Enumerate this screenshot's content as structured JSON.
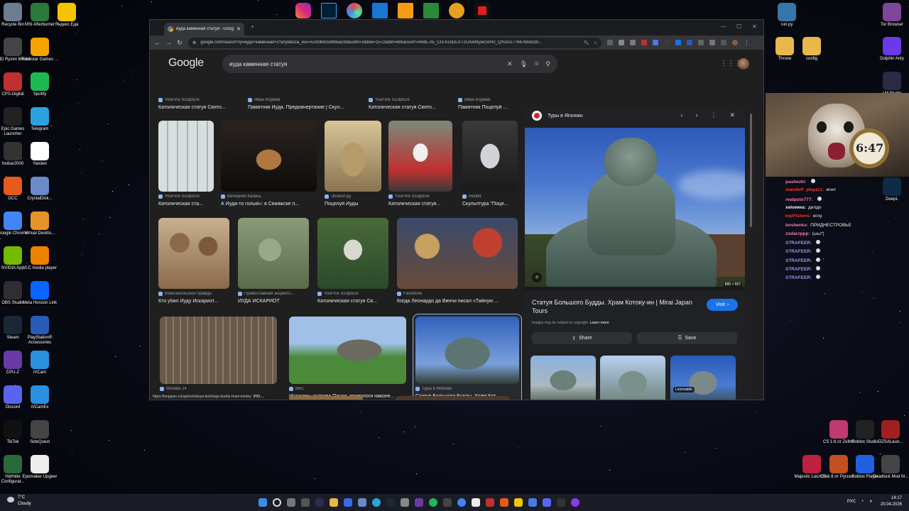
{
  "desktop": {
    "left_icons": [
      {
        "label": "Recycle Bin",
        "icon": "recycle-bin-icon",
        "color": "#6b7d8e"
      },
      {
        "label": "MSI Afterburner",
        "icon": "afterburner-icon",
        "color": "#2a7a3a"
      },
      {
        "label": "Яндекс.Еда",
        "icon": "yandex-eda-icon",
        "color": "#f5c400"
      },
      {
        "label": "AMD Ryzen Master",
        "icon": "amd-icon",
        "color": "#444"
      },
      {
        "label": "Rockstar Games ...",
        "icon": "rockstar-icon",
        "color": "#f4a300"
      },
      {
        "label": "CPS-Digital",
        "icon": "cps-icon",
        "color": "#c03030"
      },
      {
        "label": "Spotify",
        "icon": "spotify-icon",
        "color": "#1db954"
      },
      {
        "label": "Epic Games Launcher",
        "icon": "epic-icon",
        "color": "#222"
      },
      {
        "label": "Telegram",
        "icon": "telegram-icon",
        "color": "#2aa3df"
      },
      {
        "label": "foobar2000",
        "icon": "foobar-icon",
        "color": "#333"
      },
      {
        "label": "Yandex",
        "icon": "yandex-icon",
        "color": "#fff"
      },
      {
        "label": "GCC",
        "icon": "gcc-icon",
        "color": "#e85a1a"
      },
      {
        "label": "CrystalDisk...",
        "icon": "crystaldisk-icon",
        "color": "#6a8ac8"
      },
      {
        "label": "Google Chrome",
        "icon": "chrome-icon",
        "color": "#4285f4"
      },
      {
        "label": "Virtual Deskto...",
        "icon": "virtual-desktop-icon",
        "color": "#e8922a"
      },
      {
        "label": "NVIDIA App",
        "icon": "nvidia-icon",
        "color": "#76b900"
      },
      {
        "label": "VLC media player",
        "icon": "vlc-icon",
        "color": "#f08000"
      },
      {
        "label": "OBS Studio",
        "icon": "obs-icon",
        "color": "#302e31"
      },
      {
        "label": "Meta Horizon Link",
        "icon": "meta-icon",
        "color": "#0866ff"
      },
      {
        "label": "Steam",
        "icon": "steam-icon",
        "color": "#1b2838"
      },
      {
        "label": "PlayStation® Accessories",
        "icon": "playstation-icon",
        "color": "#2a5ab8"
      },
      {
        "label": "CPU-Z",
        "icon": "cpuz-icon",
        "color": "#6a3aa8"
      },
      {
        "label": "iVCam",
        "icon": "ivcam-icon",
        "color": "#2a90e0"
      },
      {
        "label": "Discord",
        "icon": "discord-icon",
        "color": "#5865f2"
      },
      {
        "label": "iVCamEx",
        "icon": "ivcamex-icon",
        "color": "#2a90e0"
      },
      {
        "label": "TikTok",
        "icon": "tiktok-icon",
        "color": "#111"
      },
      {
        "label": "SideQuest",
        "icon": "sidequest-icon",
        "color": "#444"
      },
      {
        "label": "HidHide Configurat...",
        "icon": "hidhide-icon",
        "color": "#2a6a3a"
      },
      {
        "label": "Epomaker Upgeer",
        "icon": "epomaker-icon",
        "color": "#eee"
      }
    ],
    "right_icons": [
      {
        "label": "run.py",
        "icon": "python-file-icon",
        "color": "#3776ab"
      },
      {
        "label": "Tor Browser",
        "icon": "tor-icon",
        "color": "#7d4698"
      },
      {
        "label": "Throne",
        "icon": "folder-icon",
        "color": "#e8b84a"
      },
      {
        "label": "config",
        "icon": "folder-icon",
        "color": "#e8b84a"
      },
      {
        "label": "Dolphin Anty",
        "icon": "dolphin-icon",
        "color": "#6a3ae8"
      },
      {
        "label": "LM Studio",
        "icon": "lmstudio-icon",
        "color": "#2a2a44"
      },
      {
        "label": "DeepL",
        "icon": "deepl-icon",
        "color": "#0f2b46"
      },
      {
        "label": "CS 1.6 от Zeihts",
        "icon": "cs-icon",
        "color": "#c03a70"
      },
      {
        "label": "Roblox Studio",
        "icon": "roblox-studio-icon",
        "color": "#222"
      },
      {
        "label": "DZSALaun...",
        "icon": "dzsa-icon",
        "color": "#a02020"
      },
      {
        "label": "Majestic Launcher",
        "icon": "majestic-icon",
        "color": "#c02040"
      },
      {
        "label": "CS 1.6 от Русско...",
        "icon": "cs-icon",
        "color": "#c05020"
      },
      {
        "label": "Roblox Player",
        "icon": "roblox-icon",
        "color": "#2060e0"
      },
      {
        "label": "Deadlock Mod M...",
        "icon": "deadlock-icon",
        "color": "#444"
      }
    ]
  },
  "browser": {
    "tab_title": "иуда каменная статуя - Googl",
    "url": "google.com/search?q=иуда+каменная+статуя&sca_esv=5230b4c598b5ac93&udm=2&biw=1572&bih=895&sxsrf=ANbL-n5_CO-K2oDLXT2UAx94jJecSrRz_Q%3A177667659330...",
    "status_url": "https://funjapan.ru/sights/statuya-bolshogo-buddy-hram-kotoku"
  },
  "google": {
    "logo": "Google",
    "query": "иуда каменная статуя",
    "top_row": [
      {
        "source": "YouFine Sculpture",
        "caption": "Католическая статуя Свято..."
      },
      {
        "source": "Иван Коржев",
        "caption": "Памятник Иуда. Предначертание | Скул..."
      },
      {
        "source": "YouFine Sculpture",
        "caption": "Католическая статуя Свято..."
      },
      {
        "source": "Иван Коржев",
        "caption": "Памятник Поцелуй ..."
      }
    ],
    "row1": [
      {
        "source": "YouFine Sculpture",
        "caption": "Католическая ста..."
      },
      {
        "source": "Вечерняя Казань",
        "caption": "А Иуда-то голый»: в Свияжске п..."
      },
      {
        "source": "Экзегет.ру",
        "caption": "Поцелуй Иуды"
      },
      {
        "source": "YouFine Sculpture",
        "caption": "Католическая статуя..."
      },
      {
        "source": "Reddit",
        "caption": "Скульптура \"Поце..."
      }
    ],
    "row2": [
      {
        "source": "Комсомольской правды",
        "caption": "Кто убил Иуду Искариот..."
      },
      {
        "source": "Православная энцикло...",
        "caption": "ИУДА ИСКАРИОТ"
      },
      {
        "source": "YouFine Sculpture",
        "caption": "Католическая статуя Св..."
      },
      {
        "source": "Facebook",
        "caption": "Когда Леонардо да Винчи писал «Тайную ..."
      }
    ],
    "row3": [
      {
        "source": "Москва 24",
        "caption": "Стоунхендж, Мачу-Пикчу и Делийская коло..."
      },
      {
        "source": "BBC",
        "caption": "Истуканы острова Пасхи: археологи наконе..."
      },
      {
        "source": "Туры в Японию",
        "caption": "Статуя Большого Будды. Храм Кот..."
      }
    ],
    "panel": {
      "site": "Туры в Японию",
      "dims": "889 × 667",
      "title": "Статуя Большого Будды. Храм Котоку-ин | Mirai Japan Tours",
      "visit": "Visit",
      "copyright": "Images may be subject to copyright.",
      "learn_more": "Learn more",
      "share": "Share",
      "save": "Save",
      "related": [
        {
          "source": "Мои 100 дорог",
          "badge": ""
        },
        {
          "source": "",
          "badge": ""
        },
        {
          "source": "Freepik",
          "badge": "Licensable"
        }
      ]
    }
  },
  "chat": {
    "overlay_number": "6:47",
    "messages": [
      {
        "user": "pashezki:",
        "text": "",
        "color": "#ff80c0"
      },
      {
        "user": "standoff_player1:",
        "text": "игил",
        "color": "#ff4040"
      },
      {
        "user": "realputo777:",
        "text": "",
        "color": "#ff80c0"
      },
      {
        "user": "xelowwa:",
        "text": "дилдо",
        "color": "#ffffff"
      },
      {
        "user": "topPistons:",
        "text": "иглу",
        "color": "#ff4040"
      },
      {
        "user": "beshenks:",
        "text": "ПРИДНЕСТРОВЬЕ",
        "color": "#ff80c0"
      },
      {
        "user": "zodarzppp:",
        "text": "(ωω*)",
        "color": "#ff80c0"
      },
      {
        "user": "STRAFEER:",
        "text": "",
        "color": "#a0a0ff"
      },
      {
        "user": "STRAFEER:",
        "text": "",
        "color": "#a0a0ff"
      },
      {
        "user": "STRAFEER:",
        "text": "",
        "color": "#a0a0ff"
      },
      {
        "user": "STRAFEER:",
        "text": "",
        "color": "#a0a0ff"
      },
      {
        "user": "STRAFEER:",
        "text": "",
        "color": "#a0a0ff"
      }
    ]
  },
  "taskbar": {
    "weather_temp": "7°C",
    "weather_text": "Cloudy",
    "lang": "РУС",
    "time": "14:17",
    "date": "20.04.2026"
  }
}
